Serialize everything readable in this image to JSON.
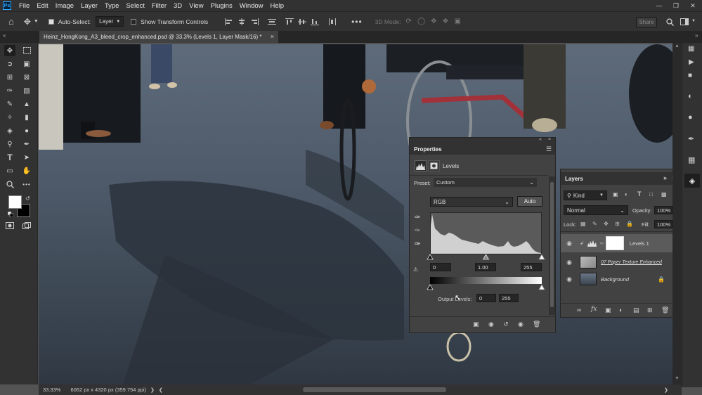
{
  "app": {
    "logo": "Ps"
  },
  "menu": [
    "File",
    "Edit",
    "Image",
    "Layer",
    "Type",
    "Select",
    "Filter",
    "3D",
    "View",
    "Plugins",
    "Window",
    "Help"
  ],
  "options_bar": {
    "auto_select_label": "Auto-Select:",
    "auto_select_target": "Layer",
    "show_transform_label": "Show Transform Controls",
    "mode_3d_label": "3D Mode:",
    "share_label": "Share"
  },
  "document": {
    "tab_title": "Heinz_HongKong_A3_bleed_crop_enhanced.psd @ 33.3% (Levels 1, Layer Mask/16) *"
  },
  "status": {
    "zoom": "33.33%",
    "doc_size": "6062 px x 4320 px (359.754 ppi)"
  },
  "properties": {
    "title": "Properties",
    "adjustment_label": "Levels",
    "preset_label": "Preset:",
    "preset_value": "Custom",
    "channel_value": "RGB",
    "auto_label": "Auto",
    "input_black": "0",
    "input_gamma": "1.00",
    "input_white": "255",
    "output_label": "Output Levels:",
    "output_black": "0",
    "output_white": "255",
    "levels": {
      "input_black": 0,
      "input_gamma": 1.0,
      "input_white": 255,
      "output_black": 0,
      "output_white": 255
    }
  },
  "layers": {
    "title": "Layers",
    "filter_kind": "Kind",
    "blend_mode": "Normal",
    "opacity_label": "Opacity:",
    "opacity_value": "100%",
    "lock_label": "Lock:",
    "fill_label": "Fill:",
    "fill_value": "100%",
    "items": [
      {
        "name": "Levels 1",
        "selected": true
      },
      {
        "name": "07 Paper Texture Enhanced",
        "selected": false
      },
      {
        "name": "Background",
        "selected": false
      }
    ]
  },
  "colors": {
    "ui_dark": "#323232",
    "panel": "#424242",
    "accent": "#31a8ff"
  }
}
